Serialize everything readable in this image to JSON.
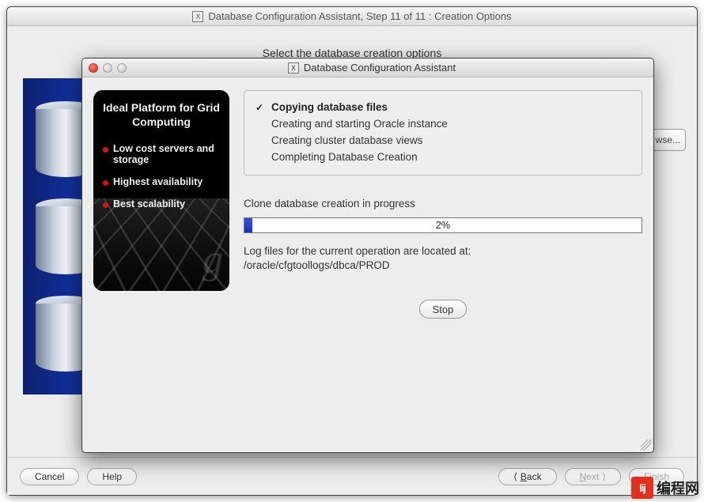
{
  "parent_window": {
    "title": "Database Configuration Assistant, Step 11 of 11 : Creation Options",
    "partial_prompt": "Select the database creation options",
    "browse_fragment": "wse...",
    "nav": {
      "cancel": "Cancel",
      "help": "Help",
      "back": "Back",
      "next": "Next",
      "finish": "Finish",
      "back_arrow": "⟨",
      "next_arrow": "⟩"
    }
  },
  "modal": {
    "title": "Database Configuration Assistant",
    "promo": {
      "heading": "Ideal Platform for Grid Computing",
      "items": [
        "Low cost servers and storage",
        "Highest availability",
        "Best scalability"
      ],
      "glyph": "g"
    },
    "steps": [
      {
        "label": "Copying database files",
        "current": true
      },
      {
        "label": "Creating and starting Oracle instance",
        "current": false
      },
      {
        "label": "Creating cluster database views",
        "current": false
      },
      {
        "label": "Completing Database Creation",
        "current": false
      }
    ],
    "status_label": "Clone database creation in progress",
    "progress": {
      "percent": 2,
      "display": "2%"
    },
    "log_intro": "Log files for the current operation are located at:",
    "log_path": "/oracle/cfgtoollogs/dbca/PROD",
    "stop": "Stop"
  },
  "watermark": {
    "badge": "lij",
    "text": "编程网"
  }
}
